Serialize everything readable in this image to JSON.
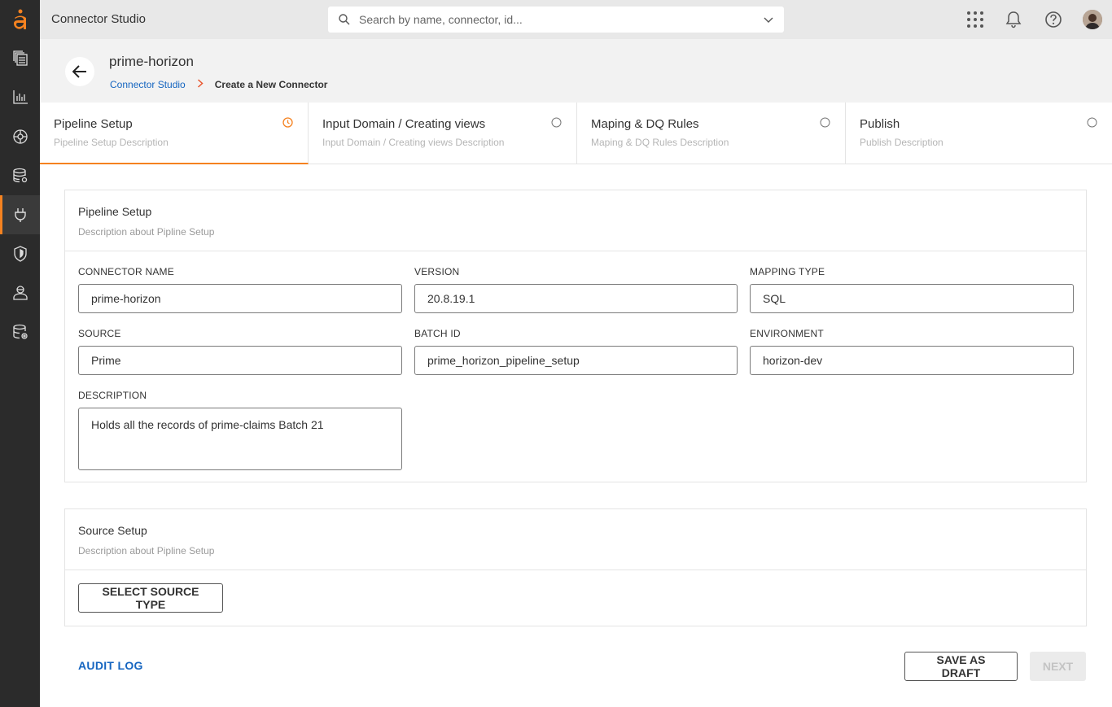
{
  "app": {
    "title": "Connector Studio",
    "logo": "a"
  },
  "search": {
    "placeholder": "Search by name, connector, id..."
  },
  "header": {
    "title": "prime-horizon",
    "breadcrumb": [
      {
        "label": "Connector Studio"
      },
      {
        "label": "Create a New Connector"
      }
    ]
  },
  "steps": [
    {
      "title": "Pipeline Setup",
      "description": "Pipeline Setup Description",
      "status": "in-progress"
    },
    {
      "title": "Input Domain / Creating views",
      "description": "Input Domain / Creating views Description",
      "status": "pending"
    },
    {
      "title": "Maping & DQ Rules",
      "description": "Maping & DQ Rules Description",
      "status": "pending"
    },
    {
      "title": "Publish",
      "description": "Publish Description",
      "status": "pending"
    }
  ],
  "pipeline_setup": {
    "title": "Pipeline Setup",
    "description": "Description about Pipline Setup",
    "fields": {
      "connector_name": {
        "label": "CONNECTOR NAME",
        "value": "prime-horizon"
      },
      "version": {
        "label": "VERSION",
        "value": "20.8.19.1"
      },
      "mapping_type": {
        "label": "MAPPING TYPE",
        "value": "SQL"
      },
      "source": {
        "label": "SOURCE",
        "value": "Prime"
      },
      "batch_id": {
        "label": "BATCH ID",
        "value": "prime_horizon_pipeline_setup"
      },
      "environment": {
        "label": "ENVIRONMENT",
        "value": "horizon-dev"
      },
      "description": {
        "label": "DESCRIPTION",
        "value": "Holds all the records of prime-claims Batch 21"
      }
    }
  },
  "source_setup": {
    "title": "Source Setup",
    "description": "Description about Pipline Setup",
    "select_button": "SELECT SOURCE TYPE"
  },
  "footer": {
    "audit_log": "AUDIT LOG",
    "save_draft": "SAVE AS DRAFT",
    "next": "NEXT"
  },
  "colors": {
    "accent": "#f58220",
    "link": "#1565c0",
    "sidebar": "#2b2b2b"
  }
}
